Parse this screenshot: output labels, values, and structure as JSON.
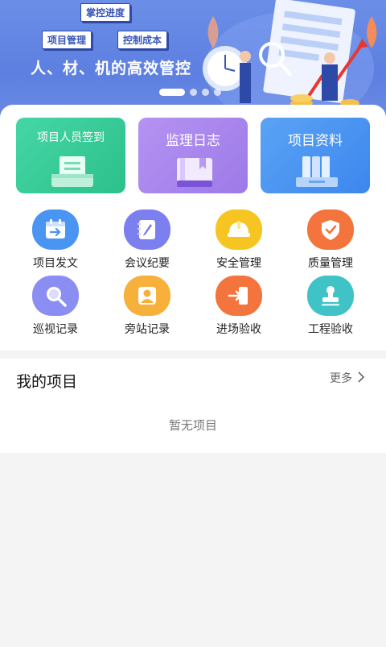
{
  "banner": {
    "tag_progress": "掌控进度",
    "tag_project": "项目管理",
    "tag_cost": "控制成本",
    "slogan": "人、材、机的高效管控"
  },
  "quick_actions": [
    {
      "label": "项目人员签到",
      "icon": "document-tray-icon",
      "color": "#38cc98"
    },
    {
      "label": "监理日志",
      "icon": "book-icon",
      "color": "#a886ee"
    },
    {
      "label": "项目资料",
      "icon": "binder-shelf-icon",
      "color": "#4b95f2"
    }
  ],
  "grid": [
    {
      "label": "项目发文",
      "icon": "calendar-arrow-icon",
      "color": "#4b95f2"
    },
    {
      "label": "会议纪要",
      "icon": "notebook-pen-icon",
      "color": "#7c7ff0"
    },
    {
      "label": "安全管理",
      "icon": "helmet-icon",
      "color": "#f6c521"
    },
    {
      "label": "质量管理",
      "icon": "shield-check-icon",
      "color": "#f3743c"
    },
    {
      "label": "巡视记录",
      "icon": "magnifier-icon",
      "color": "#8a8ef2"
    },
    {
      "label": "旁站记录",
      "icon": "person-icon",
      "color": "#f7b03a"
    },
    {
      "label": "进场验收",
      "icon": "enter-door-icon",
      "color": "#f3743c"
    },
    {
      "label": "工程验收",
      "icon": "stamp-icon",
      "color": "#3fc3c7"
    }
  ],
  "my_projects": {
    "title": "我的项目",
    "more": "更多",
    "empty": "暂无项目"
  }
}
